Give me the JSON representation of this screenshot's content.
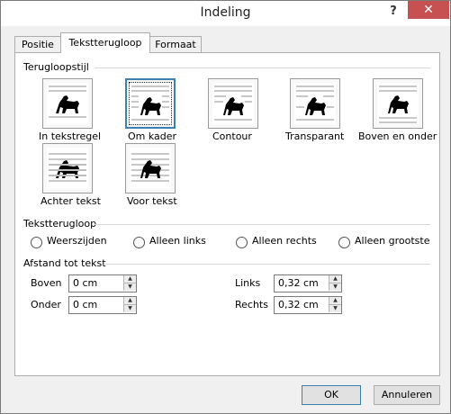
{
  "window": {
    "title": "Indeling",
    "help_label": "?",
    "close_label": "✕"
  },
  "tabs": [
    {
      "label": "Positie"
    },
    {
      "label": "Tekstterugloop"
    },
    {
      "label": "Formaat"
    }
  ],
  "wrap_style": {
    "heading": "Terugloopstijl",
    "options": [
      {
        "label": "In tekstregel"
      },
      {
        "label": "Om kader"
      },
      {
        "label": "Contour"
      },
      {
        "label": "Transparant"
      },
      {
        "label": "Boven en onder"
      },
      {
        "label": "Achter tekst"
      },
      {
        "label": "Voor tekst"
      }
    ],
    "selected": "Om kader"
  },
  "wrap_text": {
    "heading": "Tekstterugloop",
    "options": [
      {
        "label": "Weerszijden"
      },
      {
        "label": "Alleen links"
      },
      {
        "label": "Alleen rechts"
      },
      {
        "label": "Alleen grootste"
      }
    ]
  },
  "distance": {
    "heading": "Afstand tot tekst",
    "top_label": "Boven",
    "top_value": "0 cm",
    "bottom_label": "Onder",
    "bottom_value": "0 cm",
    "left_label": "Links",
    "left_value": "0,32 cm",
    "right_label": "Rechts",
    "right_value": "0,32 cm"
  },
  "buttons": {
    "ok": "OK",
    "cancel": "Annuleren"
  },
  "colors": {
    "close_bg": "#c75050",
    "selection_border": "#3c7fb1"
  }
}
